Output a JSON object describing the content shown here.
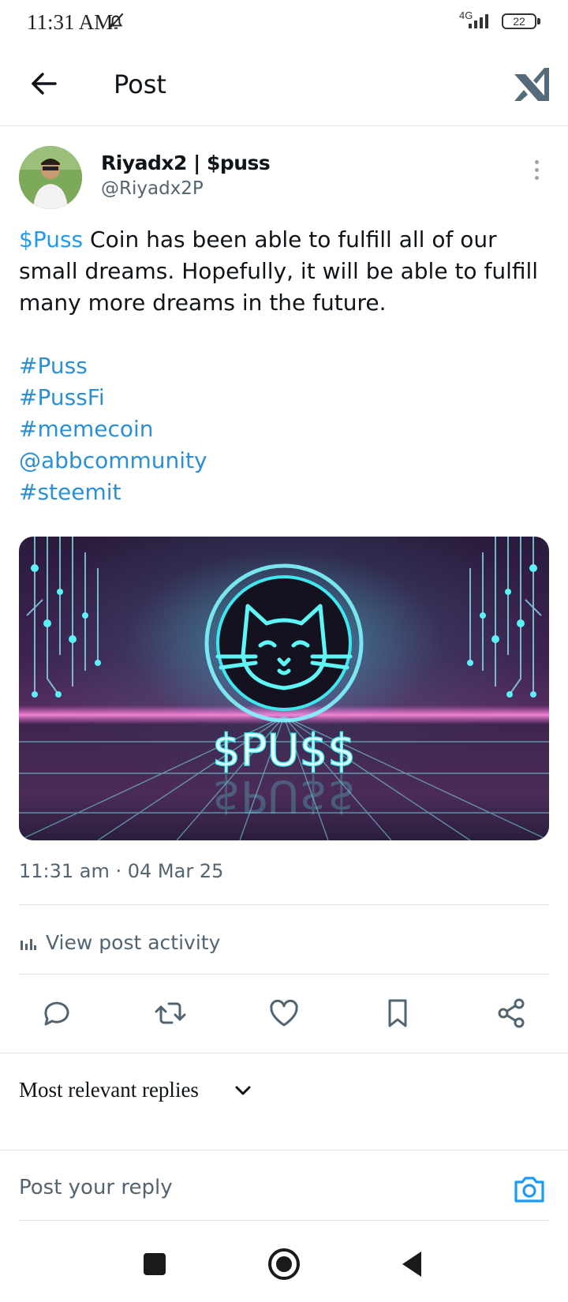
{
  "status_bar": {
    "time": "11:31 AM",
    "network": "4G",
    "battery": "22"
  },
  "header": {
    "title": "Post"
  },
  "author": {
    "name": "Riyadx2 | $puss",
    "handle": "@Riyadx2P"
  },
  "post": {
    "cashtag": "$Puss",
    "text": " Coin has been able to fulfill all of our small dreams. Hopefully, it will be able to fulfill many more dreams in the future.",
    "tags": [
      "#Puss",
      "#PussFi",
      "#memecoin",
      "@abbcommunity",
      "#steemit"
    ],
    "image_caption": "$PU$$",
    "timestamp": "11:31 am · 04 Mar 25"
  },
  "activity": {
    "label": "View post activity"
  },
  "actions": [
    "reply-icon",
    "repost-icon",
    "like-icon",
    "bookmark-icon",
    "share-icon"
  ],
  "replies": {
    "sort_label": "Most relevant replies",
    "placeholder": "Post your reply"
  },
  "colors": {
    "link": "#1d9bf0",
    "text": "#0f1419",
    "muted": "#536471",
    "neon": "#3ff0f0"
  }
}
